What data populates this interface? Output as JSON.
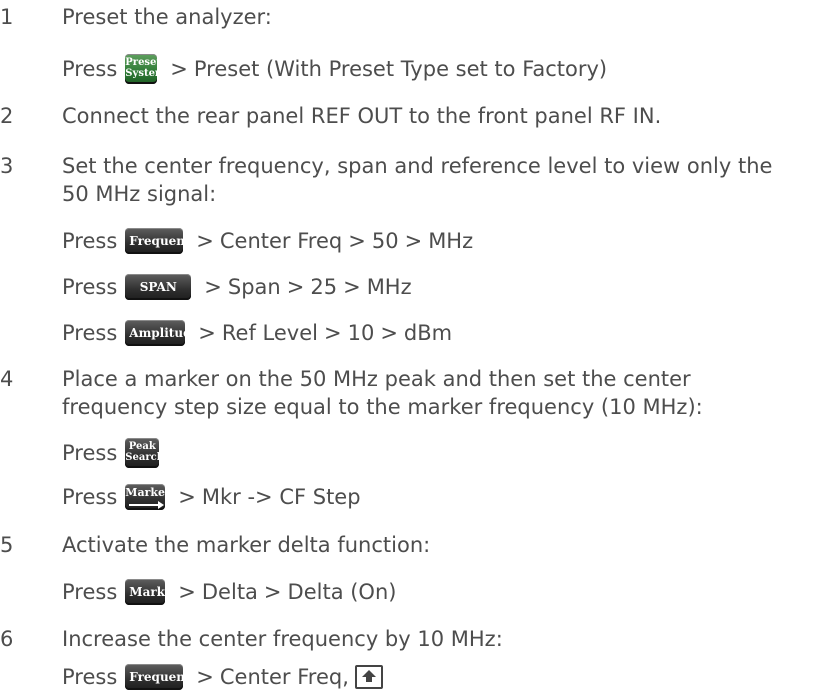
{
  "steps": [
    {
      "num": "1",
      "text": "Preset the analyzer:"
    },
    {
      "num": "2",
      "text": "Connect the rear panel REF OUT to the front panel RF IN."
    },
    {
      "num": "3",
      "lines": [
        "Set the center frequency, span and reference level to view only the",
        "50 MHz signal:"
      ]
    },
    {
      "num": "4",
      "lines": [
        "Place a marker on the 50 MHz peak and then set the center",
        "frequency step size equal to the marker frequency (10 MHz):"
      ]
    },
    {
      "num": "5",
      "text": "Activate the marker delta function:"
    },
    {
      "num": "6",
      "text": "Increase the center frequency by 10 MHz:"
    }
  ],
  "press_label": "Press",
  "separator": ">",
  "keys": {
    "preset_system": [
      "Preset/",
      "System"
    ],
    "frequency": "Frequenc",
    "span": "SPAN",
    "amplitude": "Amplitud",
    "peak_search": [
      "Peak",
      "Search"
    ],
    "marker_to": "Marker",
    "marker": "Marke"
  },
  "instructions": {
    "s1": {
      "rest": "Preset (With Preset Type set to Factory)"
    },
    "s3a": {
      "items": [
        "Center Freq",
        "50",
        "MHz"
      ]
    },
    "s3b": {
      "items": [
        "Span",
        "25",
        "MHz"
      ]
    },
    "s3c": {
      "items": [
        "Ref Level",
        "10",
        "dBm"
      ]
    },
    "s4b": {
      "items": [
        "Mkr -> CF Step"
      ]
    },
    "s5": {
      "items": [
        "Delta",
        "Delta (On)"
      ]
    },
    "s6": {
      "items": [
        "Center Freq,"
      ]
    }
  },
  "colors": {
    "text": "#4d4d4d",
    "key_bg": "#2f2f2f",
    "key_green": "#2e7a35"
  }
}
